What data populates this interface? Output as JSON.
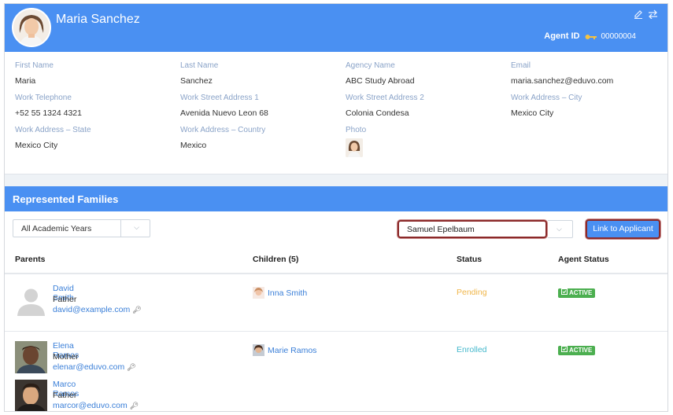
{
  "header": {
    "name": "Maria Sanchez",
    "agent_id_label": "Agent ID",
    "agent_id": "00000004",
    "icons": [
      "edit-icon",
      "swap-icon",
      "key-icon"
    ]
  },
  "details": {
    "fields": [
      {
        "label": "First Name",
        "value": "Maria"
      },
      {
        "label": "Last Name",
        "value": "Sanchez"
      },
      {
        "label": "Agency Name",
        "value": "ABC Study Abroad"
      },
      {
        "label": "Email",
        "value": "maria.sanchez@eduvo.com"
      },
      {
        "label": "Work Telephone",
        "value": "+52 55 1324 4321"
      },
      {
        "label": "Work Street Address 1",
        "value": "Avenida Nuevo Leon 68"
      },
      {
        "label": "Work Street Address 2",
        "value": "Colonia Condesa"
      },
      {
        "label": "Work Address – City",
        "value": "Mexico City"
      },
      {
        "label": "Work Address – State",
        "value": "Mexico City"
      },
      {
        "label": "Work Address – Country",
        "value": "Mexico"
      },
      {
        "label": "Photo",
        "value": ""
      }
    ]
  },
  "families": {
    "title": "Represented Families",
    "year_filter": "All Academic Years",
    "applicant_value": "Samuel Epelbaum",
    "link_button": "Link to Applicant",
    "columns": {
      "parents": "Parents",
      "children": "Children (5)",
      "status": "Status",
      "agent_status": "Agent Status"
    },
    "rows": [
      {
        "parents": [
          {
            "name": "David Smith",
            "role": "Father",
            "email": "david@example.com"
          }
        ],
        "child": "Inna Smith",
        "status": "Pending",
        "agent_status": "ACTIVE"
      },
      {
        "parents": [
          {
            "name": "Elena Ramos",
            "role": "Mother",
            "email": "elenar@eduvo.com"
          },
          {
            "name": "Marco Ramos",
            "role": "Father",
            "email": "marcor@eduvo.com"
          }
        ],
        "child": "Marie Ramos",
        "status": "Enrolled",
        "agent_status": "ACTIVE"
      }
    ]
  },
  "colors": {
    "brand_blue": "#4a90f2",
    "pending": "#f0b64a",
    "enrolled": "#45b8cc",
    "active_badge": "#4caf50",
    "highlight_border": "#8b2a2a"
  }
}
